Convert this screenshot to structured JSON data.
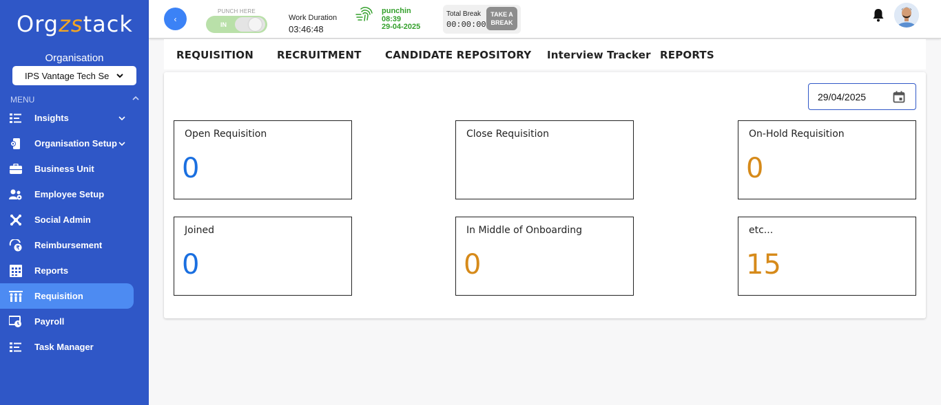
{
  "app": {
    "logo_text_a": "Org",
    "logo_text_b": "zs",
    "logo_text_c": "tack"
  },
  "sidebar": {
    "org_label": "Organisation",
    "org_selected": "IPS Vantage Tech Se",
    "menu_header": "MENU",
    "items": [
      {
        "label": "Insights",
        "icon": "insights-icon",
        "has_chevron": true
      },
      {
        "label": "Organisation Setup",
        "icon": "organisation-setup-icon",
        "has_chevron": true
      },
      {
        "label": "Business Unit",
        "icon": "briefcase-icon"
      },
      {
        "label": "Employee Setup",
        "icon": "employee-setup-icon"
      },
      {
        "label": "Social Admin",
        "icon": "social-admin-icon"
      },
      {
        "label": "Reimbursement",
        "icon": "reimbursement-icon"
      },
      {
        "label": "Reports",
        "icon": "reports-icon"
      },
      {
        "label": "Requisition",
        "icon": "requisition-icon",
        "active": true
      },
      {
        "label": "Payroll",
        "icon": "payroll-icon"
      },
      {
        "label": "Task Manager",
        "icon": "task-manager-icon"
      }
    ]
  },
  "header": {
    "back_icon": "‹",
    "punch_label": "PUNCH HERE",
    "punch_state": "IN",
    "work_duration_label": "Work Duration",
    "work_duration_value": "03:46:48",
    "punch_status": "punchin",
    "punch_time": "08:39",
    "punch_date": "29-04-2025",
    "total_break_label": "Total Break",
    "total_break_value": "00:00:00",
    "take_break_line1": "TAKE A",
    "take_break_line2": "BREAK"
  },
  "tabs": [
    "REQUISITION",
    "RECRUITMENT",
    "CANDIDATE REPOSITORY",
    "Interview Tracker",
    "REPORTS"
  ],
  "filter": {
    "date": "29/04/2025"
  },
  "cards": [
    {
      "title": "Open Requisition",
      "value": "0",
      "color": "#1a6fe0"
    },
    {
      "title": "Close Requisition",
      "value": "",
      "color": "#1a6fe0"
    },
    {
      "title": "On-Hold Requisition",
      "value": "0",
      "color": "#d68a1a"
    },
    {
      "title": "Joined",
      "value": "0",
      "color": "#1a6fe0"
    },
    {
      "title": "In Middle of Onboarding",
      "value": "0",
      "color": "#d68a1a"
    },
    {
      "title": "etc...",
      "value": "15",
      "color": "#d68a1a"
    }
  ],
  "colors": {
    "sidebar": "#2f57c7",
    "active_item": "#4d8bf2",
    "accent": "#3b82f6",
    "punch_green": "#34a02c"
  }
}
